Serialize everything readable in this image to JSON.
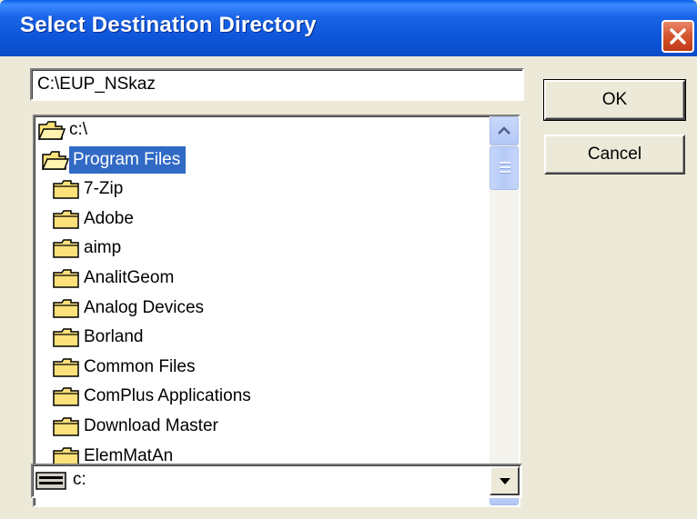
{
  "window": {
    "title": "Select Destination Directory"
  },
  "path_input": {
    "value": "C:\\EUP_NSkaz"
  },
  "buttons": {
    "ok": "OK",
    "cancel": "Cancel"
  },
  "folders": [
    {
      "label": "c:\\",
      "open": true,
      "indent": 0,
      "selected": false
    },
    {
      "label": "Program Files",
      "open": true,
      "indent": 1,
      "selected": true
    },
    {
      "label": "7-Zip",
      "open": false,
      "indent": 2,
      "selected": false
    },
    {
      "label": "Adobe",
      "open": false,
      "indent": 2,
      "selected": false
    },
    {
      "label": "aimp",
      "open": false,
      "indent": 2,
      "selected": false
    },
    {
      "label": "AnalitGeom",
      "open": false,
      "indent": 2,
      "selected": false
    },
    {
      "label": "Analog Devices",
      "open": false,
      "indent": 2,
      "selected": false
    },
    {
      "label": "Borland",
      "open": false,
      "indent": 2,
      "selected": false
    },
    {
      "label": "Common Files",
      "open": false,
      "indent": 2,
      "selected": false
    },
    {
      "label": "ComPlus Applications",
      "open": false,
      "indent": 2,
      "selected": false
    },
    {
      "label": "Download Master",
      "open": false,
      "indent": 2,
      "selected": false
    },
    {
      "label": "ElemMatAn",
      "open": false,
      "indent": 2,
      "selected": false
    }
  ],
  "drive_select": {
    "value": "c:"
  },
  "colors": {
    "selection": "#316ac5",
    "folder": "#fce07a",
    "titlebar": "#0a54d8",
    "close": "#d4532d"
  }
}
